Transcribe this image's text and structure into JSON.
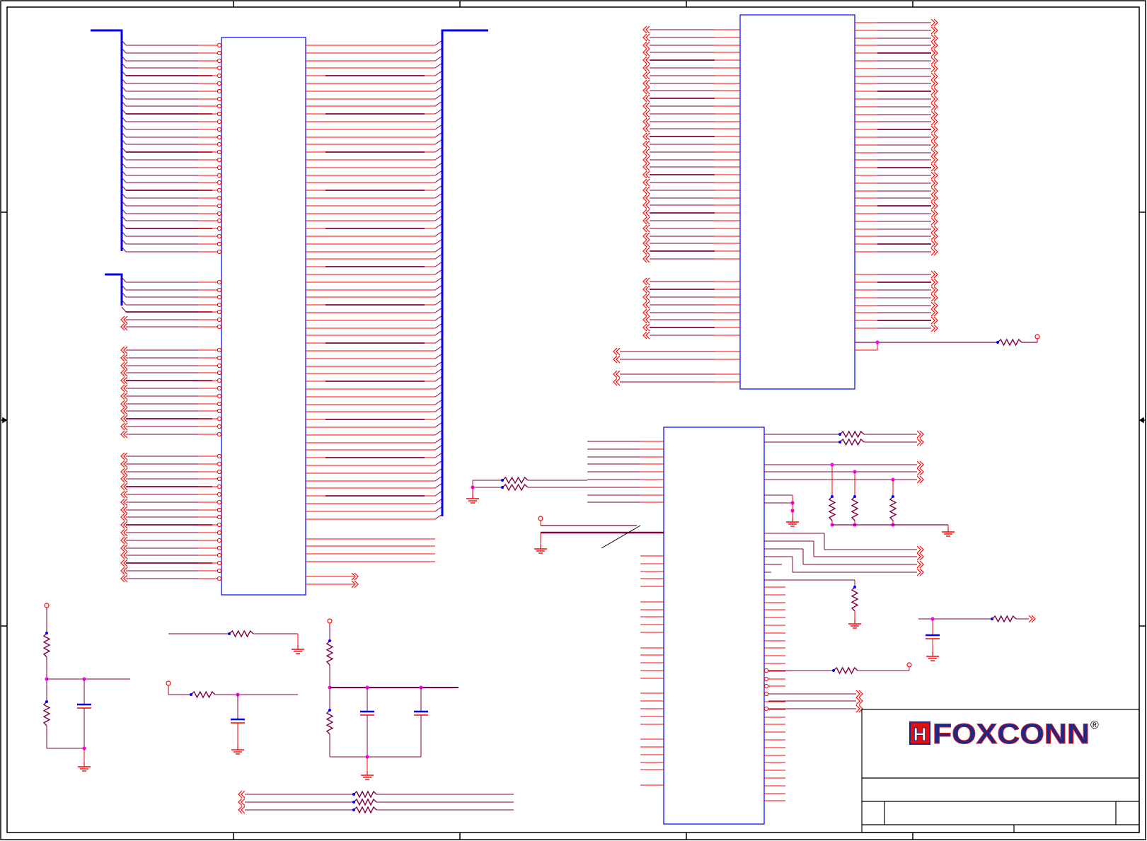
{
  "title_block": {
    "company_logo": "FOXCONN",
    "registered_mark": "®"
  },
  "colors": {
    "net_wire": "#ff0000",
    "bus_wire": "#800040",
    "bus_trunk": "#0000ff",
    "component_outline": "#0000ff",
    "junction_dot": "#ff00ff",
    "frame": "#000000",
    "logo_fill": "#1a2a8a",
    "logo_accent": "#e01010"
  }
}
